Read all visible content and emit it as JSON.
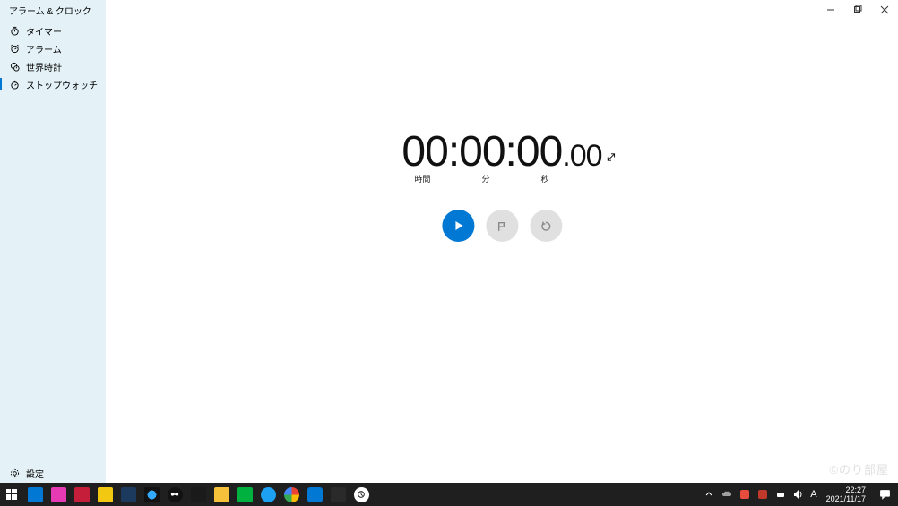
{
  "window": {
    "title": "アラーム & クロック"
  },
  "sidebar": {
    "items": [
      {
        "label": "タイマー",
        "icon": "timer-icon"
      },
      {
        "label": "アラーム",
        "icon": "alarm-icon"
      },
      {
        "label": "世界時計",
        "icon": "world-clock-icon"
      },
      {
        "label": "ストップウォッチ",
        "icon": "stopwatch-icon",
        "selected": true
      }
    ],
    "settings_label": "設定"
  },
  "stopwatch": {
    "hours": "00",
    "minutes": "00",
    "seconds": "00",
    "centiseconds": "00",
    "sep1": ":",
    "sep2": ":",
    "sep3": ".",
    "labels": {
      "hours": "時間",
      "minutes": "分",
      "seconds": "秒"
    }
  },
  "watermark": "©のり部屋",
  "taskbar": {
    "icons_colors": [
      "#0078d4",
      "#e53ab3",
      "#c41e3a",
      "#f2c811",
      "#1b3a5e",
      "#111111",
      "#404040",
      "#1a1a1a",
      "#f5c03a",
      "#00b140",
      "#1da1f2",
      "#ffffff",
      "#0078d4",
      "#2a2a2a",
      "#ffffff"
    ],
    "ime_text": "A",
    "clock_time": "22:27",
    "clock_date": "2021/11/17"
  }
}
